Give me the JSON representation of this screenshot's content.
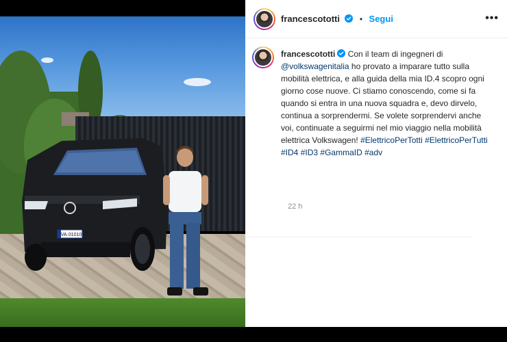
{
  "post": {
    "username": "francescototti",
    "follow_label": "Segui",
    "separator": "•",
    "more_icon": "•••",
    "caption_username": "francescototti",
    "caption_parts": {
      "p1": "Con il team di ingegneri di ",
      "mention": "@volkswagenitalia",
      "p2": " ho provato a imparare tutto sulla mobilità elettrica, e alla guida della mia ID.4 scopro ogni giorno cose nuove. Ci stiamo conoscendo, come si fa quando si entra in una nuova squadra e, devo dirvelo, continua a sorprendermi. Se volete sorprendervi anche voi, continuate a seguirmi nel mio viaggio nella mobilità elettrica Volkswagen! ",
      "tags": [
        "#ElettricoPerTotti",
        "#ElettricoPerTutti",
        "#ID4",
        "#ID3",
        "#GammaID",
        "#adv"
      ]
    },
    "time": "22 h",
    "plate": "VA·01010"
  },
  "colors": {
    "accent": "#0095f6",
    "link": "#00376b",
    "verified": "#0095f6"
  }
}
